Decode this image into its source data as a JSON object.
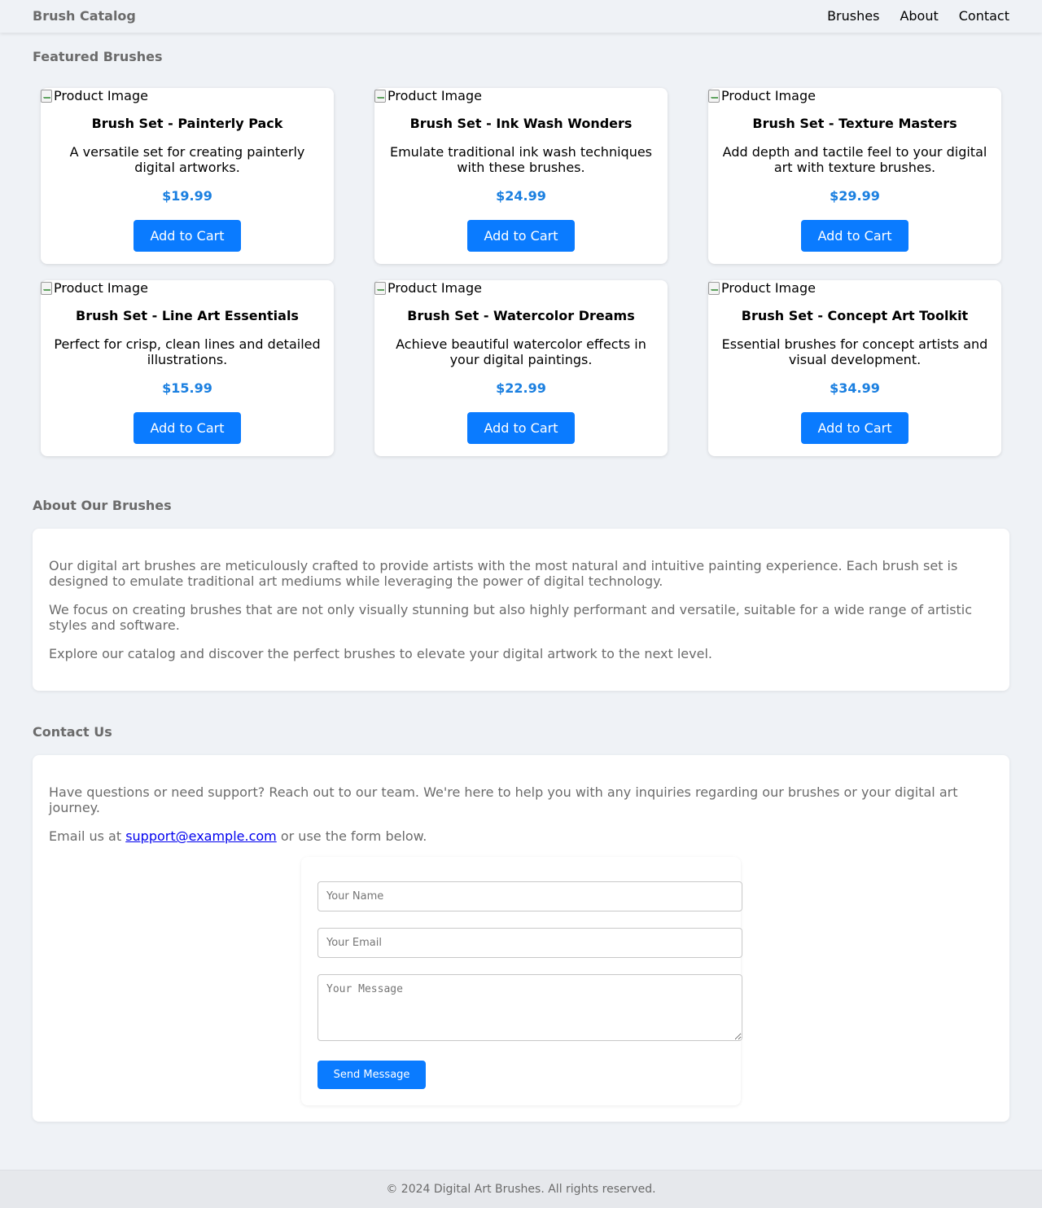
{
  "header": {
    "brand": "Brush Catalog",
    "nav": [
      "Brushes",
      "About",
      "Contact"
    ]
  },
  "featured": {
    "title": "Featured Brushes",
    "image_alt": "Product Image",
    "button_label": "Add to Cart",
    "products": [
      {
        "name": "Brush Set - Painterly Pack",
        "description": "A versatile set for creating painterly digital artworks.",
        "price": "$19.99"
      },
      {
        "name": "Brush Set - Ink Wash Wonders",
        "description": "Emulate traditional ink wash techniques with these brushes.",
        "price": "$24.99"
      },
      {
        "name": "Brush Set - Texture Masters",
        "description": "Add depth and tactile feel to your digital art with texture brushes.",
        "price": "$29.99"
      },
      {
        "name": "Brush Set - Line Art Essentials",
        "description": "Perfect for crisp, clean lines and detailed illustrations.",
        "price": "$15.99"
      },
      {
        "name": "Brush Set - Watercolor Dreams",
        "description": "Achieve beautiful watercolor effects in your digital paintings.",
        "price": "$22.99"
      },
      {
        "name": "Brush Set - Concept Art Toolkit",
        "description": "Essential brushes for concept artists and visual development.",
        "price": "$34.99"
      }
    ]
  },
  "about": {
    "title": "About Our Brushes",
    "paragraphs": [
      "Our digital art brushes are meticulously crafted to provide artists with the most natural and intuitive painting experience. Each brush set is designed to emulate traditional art mediums while leveraging the power of digital technology.",
      "We focus on creating brushes that are not only visually stunning but also highly performant and versatile, suitable for a wide range of artistic styles and software.",
      "Explore our catalog and discover the perfect brushes to elevate your digital artwork to the next level."
    ]
  },
  "contact": {
    "title": "Contact Us",
    "intro": "Have questions or need support? Reach out to our team. We're here to help you with any inquiries regarding our brushes or your digital art journey.",
    "email_prefix": "Email us at ",
    "email": "support@example.com",
    "email_suffix": " or use the form below.",
    "form": {
      "name_placeholder": "Your Name",
      "email_placeholder": "Your Email",
      "message_placeholder": "Your Message",
      "submit_label": "Send Message"
    }
  },
  "footer": {
    "text": "© 2024 Digital Art Brushes. All rights reserved."
  },
  "colors": {
    "accent": "#0a7bff",
    "price": "#1a7fe0",
    "background": "#eff2f6",
    "muted_text": "#6b6b6b"
  }
}
